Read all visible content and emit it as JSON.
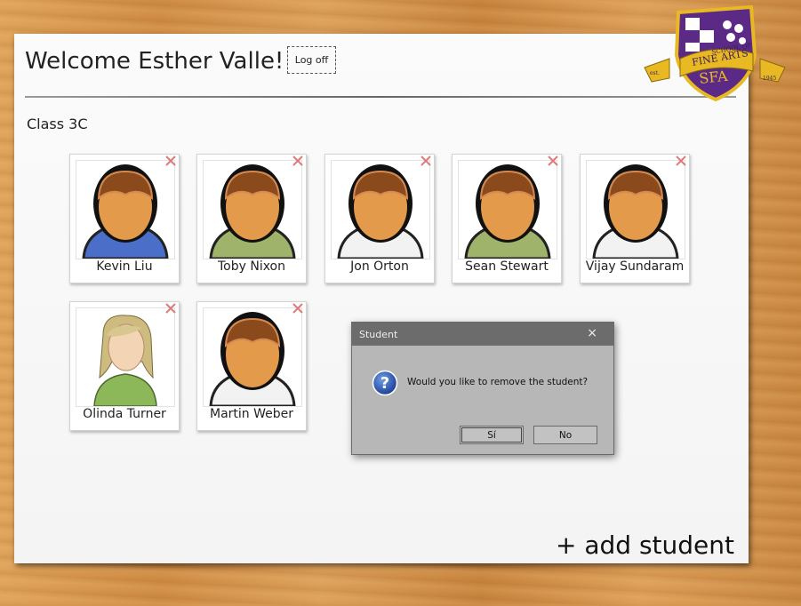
{
  "header": {
    "welcome": "Welcome Esther Valle!",
    "logoff_label": "Log off"
  },
  "class_name": "Class 3C",
  "students": [
    {
      "name": "Kevin Liu",
      "avatar": "boy-avatar-blue-sweater"
    },
    {
      "name": "Toby Nixon",
      "avatar": "boy-avatar-green-sweater"
    },
    {
      "name": "Jon Orton",
      "avatar": "boy-avatar-white-shirt"
    },
    {
      "name": "Sean Stewart",
      "avatar": "boy-avatar-green-sweater"
    },
    {
      "name": "Vijay Sundaram",
      "avatar": "boy-avatar-white-shirt"
    },
    {
      "name": "Olinda Turner",
      "avatar": "girl-avatar-green-top"
    },
    {
      "name": "Martin Weber",
      "avatar": "boy-avatar-white-shirt"
    }
  ],
  "add_student_label": "+ add student",
  "logo": {
    "school_of": "SCHOOL OF",
    "fine_arts": "FINE ARTS",
    "initials": "SFA",
    "est": "est.",
    "year": "1945"
  },
  "dialog": {
    "title": "Student",
    "close_glyph": "×",
    "message": "Would you like to remove the student?",
    "yes_label": "Sí",
    "no_label": "No"
  },
  "colors": {
    "dialog_titlebar": "#6c6c6c",
    "dialog_body": "#b7b7b7",
    "crest_purple": "#5b2a86",
    "crest_gold": "#e8b923"
  }
}
